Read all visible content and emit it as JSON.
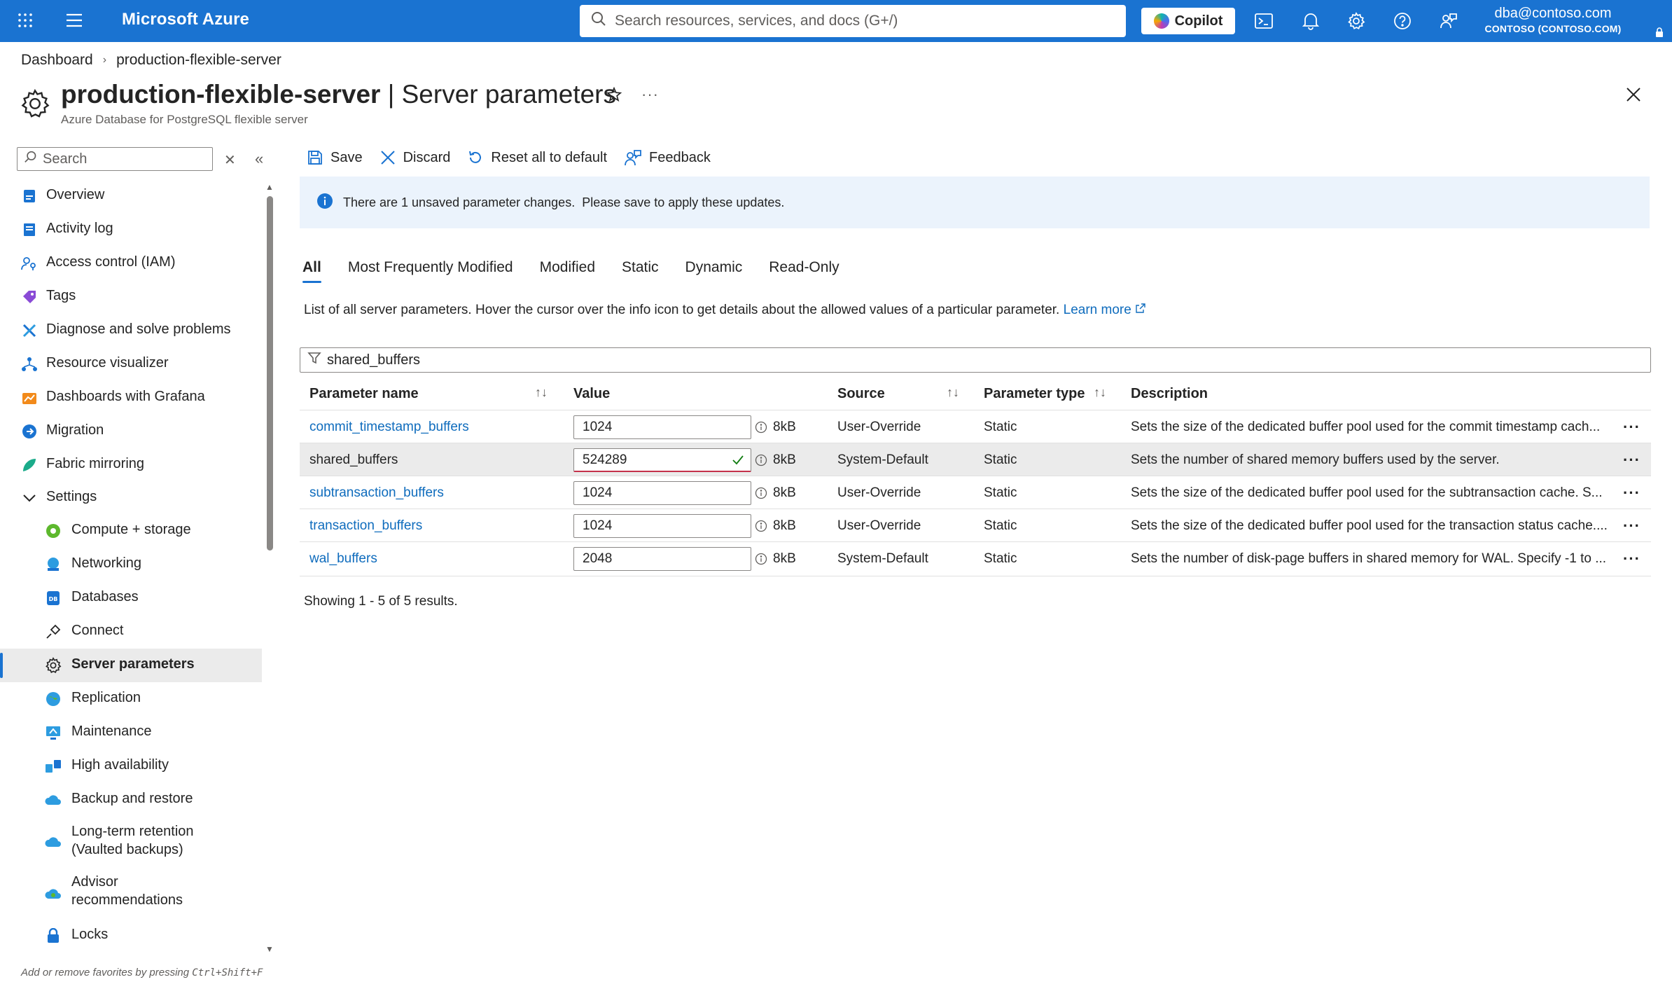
{
  "topbar": {
    "brand": "Microsoft Azure",
    "search_placeholder": "Search resources, services, and docs (G+/)",
    "copilot_label": "Copilot",
    "user_email": "dba@contoso.com",
    "user_tenant": "CONTOSO (CONTOSO.COM)",
    "bg_color": "#1a73d1"
  },
  "breadcrumb": [
    "Dashboard",
    "production-flexible-server"
  ],
  "page": {
    "resource_name": "production-flexible-server",
    "blade_name": "| Server parameters",
    "subtitle": "Azure Database for PostgreSQL flexible server"
  },
  "nav": {
    "search_placeholder": "Search",
    "favorites_hint": "Add or remove favorites by pressing",
    "favorites_shortcut": "Ctrl+Shift+F",
    "items": [
      {
        "label": "Overview",
        "icon": "overview-icon"
      },
      {
        "label": "Activity log",
        "icon": "activity-log-icon"
      },
      {
        "label": "Access control (IAM)",
        "icon": "iam-icon"
      },
      {
        "label": "Tags",
        "icon": "tag-icon"
      },
      {
        "label": "Diagnose and solve problems",
        "icon": "diagnose-icon"
      },
      {
        "label": "Resource visualizer",
        "icon": "resource-visualizer-icon"
      },
      {
        "label": "Dashboards with Grafana",
        "icon": "grafana-icon"
      },
      {
        "label": "Migration",
        "icon": "migration-icon"
      },
      {
        "label": "Fabric mirroring",
        "icon": "fabric-icon"
      },
      {
        "label": "Settings",
        "icon": "chevron-down-icon"
      },
      {
        "label": "Compute + storage",
        "icon": "compute-icon"
      },
      {
        "label": "Networking",
        "icon": "networking-icon"
      },
      {
        "label": "Databases",
        "icon": "database-icon"
      },
      {
        "label": "Connect",
        "icon": "plug-icon"
      },
      {
        "label": "Server parameters",
        "icon": "gear-icon"
      },
      {
        "label": "Replication",
        "icon": "globe-icon"
      },
      {
        "label": "Maintenance",
        "icon": "maintenance-icon"
      },
      {
        "label": "High availability",
        "icon": "high-availability-icon"
      },
      {
        "label": "Backup and restore",
        "icon": "backup-icon"
      },
      {
        "label": "Long-term retention",
        "label2": "(Vaulted backups)",
        "icon": "cloud-backup-icon"
      },
      {
        "label": "Advisor",
        "label2": "recommendations",
        "icon": "advisor-icon"
      },
      {
        "label": "Locks",
        "icon": "lock-icon"
      }
    ]
  },
  "toolbar": {
    "save": "Save",
    "discard": "Discard",
    "reset": "Reset all to default",
    "feedback": "Feedback"
  },
  "info_bar": {
    "message": "There are 1 unsaved parameter changes.  Please save to apply these updates."
  },
  "tabs": [
    "All",
    "Most Frequently Modified",
    "Modified",
    "Static",
    "Dynamic",
    "Read-Only"
  ],
  "description": {
    "text": "List of all server parameters. Hover the cursor over the info icon to get details about the allowed values of a particular parameter.",
    "link": "Learn more"
  },
  "filter": {
    "value": "shared_buffers"
  },
  "table": {
    "headers": [
      "Parameter name",
      "Value",
      "Source",
      "Parameter type",
      "Description"
    ],
    "rows": [
      {
        "name": "commit_timestamp_buffers",
        "value": "1024",
        "unit": "8kB",
        "source": "User-Override",
        "type": "Static",
        "description": "Sets the size of the dedicated buffer pool used for the commit timestamp cach..."
      },
      {
        "name": "shared_buffers",
        "value": "524289",
        "unit": "8kB",
        "source": "System-Default",
        "type": "Static",
        "description": "Sets the number of shared memory buffers used by the server."
      },
      {
        "name": "subtransaction_buffers",
        "value": "1024",
        "unit": "8kB",
        "source": "User-Override",
        "type": "Static",
        "description": "Sets the size of the dedicated buffer pool used for the subtransaction cache. S..."
      },
      {
        "name": "transaction_buffers",
        "value": "1024",
        "unit": "8kB",
        "source": "User-Override",
        "type": "Static",
        "description": "Sets the size of the dedicated buffer pool used for the transaction status cache...."
      },
      {
        "name": "wal_buffers",
        "value": "2048",
        "unit": "8kB",
        "source": "System-Default",
        "type": "Static",
        "description": "Sets the number of disk-page buffers in shared memory for WAL. Specify -1 to ..."
      }
    ],
    "footer": "Showing 1 - 5 of 5 results."
  }
}
